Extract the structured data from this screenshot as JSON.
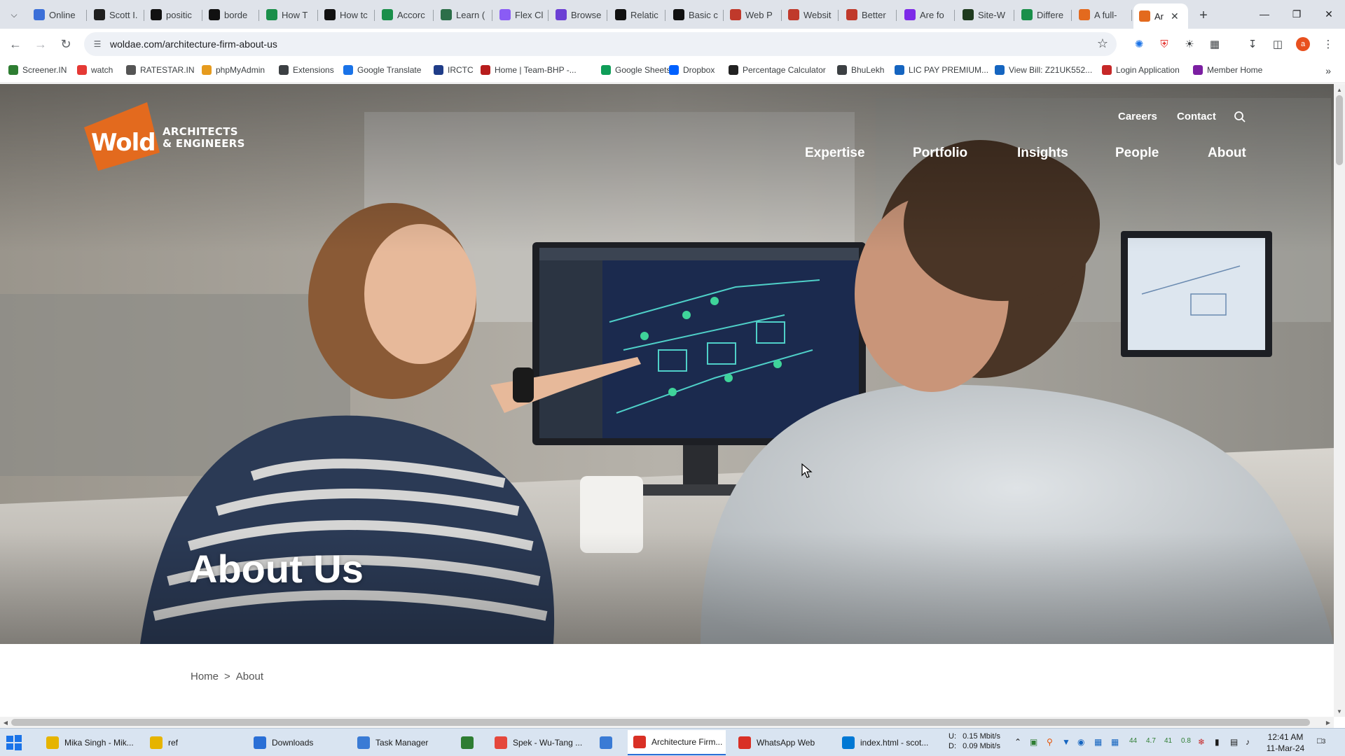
{
  "browser": {
    "tabs": [
      {
        "label": "Online",
        "icon": "circle-a-icon",
        "color": "#3b6fd8"
      },
      {
        "label": "Scott I.",
        "icon": "s-square-icon",
        "color": "#1f1f1f"
      },
      {
        "label": "positic",
        "icon": "m-square-icon",
        "color": "#111111"
      },
      {
        "label": "borde",
        "icon": "m-square-icon",
        "color": "#111111"
      },
      {
        "label": "How T",
        "icon": "w-icon",
        "color": "#1a8f4a"
      },
      {
        "label": "How tc",
        "icon": "a-square-icon",
        "color": "#111111"
      },
      {
        "label": "Accorc",
        "icon": "gg-icon",
        "color": "#1a8f4a"
      },
      {
        "label": "Learn (",
        "icon": "shield-icon",
        "color": "#2c6e49"
      },
      {
        "label": "Flex Cl",
        "icon": "swirl-icon",
        "color": "#8a5cf5"
      },
      {
        "label": "Browse",
        "icon": "b-square-icon",
        "color": "#6b3fd4"
      },
      {
        "label": "Relatic",
        "icon": "m-square-icon",
        "color": "#111111"
      },
      {
        "label": "Basic c",
        "icon": "m-square-icon",
        "color": "#111111"
      },
      {
        "label": "Web P",
        "icon": "nn-icon",
        "color": "#c0392b"
      },
      {
        "label": "Websit",
        "icon": "target-icon",
        "color": "#c0392b"
      },
      {
        "label": "Better",
        "icon": "nn-icon",
        "color": "#c0392b"
      },
      {
        "label": "Are fo",
        "icon": "flame-icon",
        "color": "#7d2ae8"
      },
      {
        "label": "Site-W",
        "icon": "n-square-icon",
        "color": "#1f3b1f"
      },
      {
        "label": "Differe",
        "icon": "gg-icon",
        "color": "#1a8f4a"
      },
      {
        "label": "A full-",
        "icon": "wold-icon",
        "color": "#e36a1e"
      },
      {
        "label": "Ar",
        "icon": "wold-icon",
        "color": "#e36a1e",
        "active": true
      }
    ],
    "url": "woldae.com/architecture-firm-about-us",
    "profile_initial": "a",
    "bookmarks": [
      {
        "label": "Screener.IN",
        "icon": "bar-chart-icon",
        "color": "#2e7d32"
      },
      {
        "label": "watch",
        "icon": "youtube-icon",
        "color": "#e53935"
      },
      {
        "label": "RATESTAR.IN",
        "icon": "star-icon",
        "color": "#555555"
      },
      {
        "label": "phpMyAdmin",
        "icon": "sail-icon",
        "color": "#e69b1e"
      },
      {
        "label": "Extensions",
        "icon": "puzzle-icon",
        "color": "#3c4043"
      },
      {
        "label": "Google Translate",
        "icon": "translate-icon",
        "color": "#1a73e8"
      },
      {
        "label": "IRCTC",
        "icon": "irctc-icon",
        "color": "#1f3c88"
      },
      {
        "label": "Home | Team-BHP -...",
        "icon": "bhp-icon",
        "color": "#b71c1c"
      },
      {
        "label": "Google Sheets",
        "icon": "sheets-icon",
        "color": "#0f9d58"
      },
      {
        "label": "Dropbox",
        "icon": "dropbox-icon",
        "color": "#0061ff"
      },
      {
        "label": "Percentage Calculator",
        "icon": "calc-icon",
        "color": "#222222"
      },
      {
        "label": "BhuLekh",
        "icon": "globe-icon",
        "color": "#3c4043"
      },
      {
        "label": "LIC PAY PREMIUM...",
        "icon": "lic-icon",
        "color": "#1565c0"
      },
      {
        "label": "View Bill: Z21UK552...",
        "icon": "bill-icon",
        "color": "#1565c0"
      },
      {
        "label": "Login Application",
        "icon": "login-icon",
        "color": "#c62828"
      },
      {
        "label": "Member Home",
        "icon": "member-icon",
        "color": "#7b1fa2"
      }
    ]
  },
  "site": {
    "logo_word": "Wold",
    "logo_tag_line1": "ARCHITECTS",
    "logo_tag_line2": "& ENGINEERS",
    "logo_color": "#e36a1e",
    "util_nav": [
      "Careers",
      "Contact"
    ],
    "main_nav": [
      "Expertise",
      "Portfolio",
      "Insights",
      "People",
      "About"
    ],
    "hero_title": "About Us",
    "breadcrumb": {
      "home": "Home",
      "sep": ">",
      "current": "About"
    }
  },
  "taskbar": {
    "items": [
      {
        "label": "Mika Singh - Mik...",
        "icon": "folder-music-icon",
        "color": "#e6b400"
      },
      {
        "label": "ref",
        "icon": "folder-icon",
        "color": "#e6b400"
      },
      {
        "label": "Downloads",
        "icon": "download-icon",
        "color": "#2a6fd6"
      },
      {
        "label": "Task Manager",
        "icon": "task-manager-icon",
        "color": "#3a7bd5"
      },
      {
        "label": "",
        "icon": "notepad-icon",
        "color": "#2e7d32"
      },
      {
        "label": "Spek - Wu-Tang ...",
        "icon": "spek-icon",
        "color": "#e5473c"
      },
      {
        "label": "",
        "icon": "document-icon",
        "color": "#3a7bd5"
      },
      {
        "label": "Architecture Firm...",
        "icon": "chrome-icon",
        "color": "#d93025",
        "active": true
      },
      {
        "label": "WhatsApp Web",
        "icon": "chrome-icon",
        "color": "#d93025"
      },
      {
        "label": "index.html - scot...",
        "icon": "vscode-icon",
        "color": "#0078d4"
      }
    ],
    "net_up_label": "U:",
    "net_up": "0.15 Mbit/s",
    "net_down_label": "D:",
    "net_down": "0.09 Mbit/s",
    "tray_numbers": [
      "44",
      "4.7",
      "41",
      "0.8"
    ],
    "time": "12:41 AM",
    "date": "11-Mar-24",
    "notif_count": "3"
  }
}
